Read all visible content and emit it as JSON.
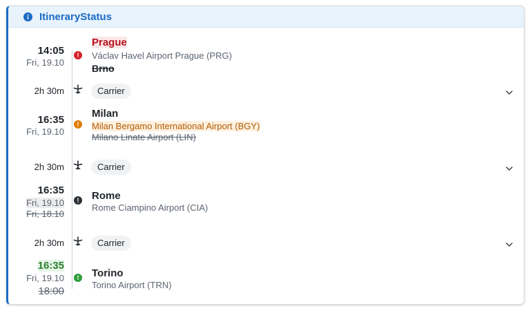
{
  "header": {
    "title": "ItineraryStatus",
    "icon": "info-icon"
  },
  "colors": {
    "accent": "#1b6bc4",
    "error": "#d62228",
    "warning": "#e07b00",
    "neutral": "#2b2f33",
    "success": "#2e9c3a"
  },
  "stops": [
    {
      "time": "14:05",
      "date": "Fri, 19.10",
      "city": "Prague",
      "airport": "Václav Havel Airport Prague (PRG)",
      "old_city": "Brno",
      "status": "error"
    },
    {
      "time": "16:35",
      "date": "Fri, 19.10",
      "city": "Milan",
      "airport": "Milan Bergamo International Airport (BGY)",
      "old_airport": "Milano Linate Airport (LIN)",
      "status": "warning"
    },
    {
      "time": "16:35",
      "date": "Fri, 19.10",
      "old_date": "Fri, 18.10",
      "city": "Rome",
      "airport": "Rome Ciampino Airport (CIA)",
      "status": "neutral"
    },
    {
      "time": "16:35",
      "date": "Fri, 19.10",
      "old_time": "18:00",
      "city": "Torino",
      "airport": "Torino Airport (TRN)",
      "status": "success"
    }
  ],
  "legs": [
    {
      "duration": "2h 30m",
      "carrier": "Carrier"
    },
    {
      "duration": "2h 30m",
      "carrier": "Carrier"
    },
    {
      "duration": "2h 30m",
      "carrier": "Carrier"
    }
  ]
}
